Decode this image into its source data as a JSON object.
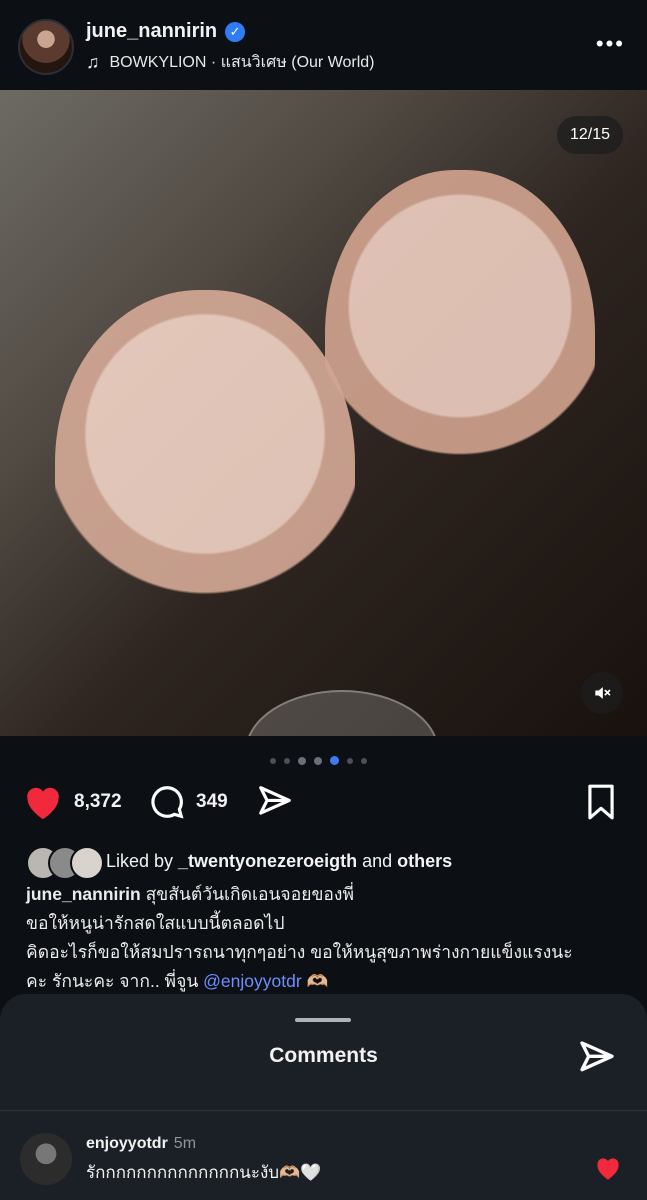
{
  "header": {
    "username": "june_nannirin",
    "music": "BOWKYLION · แสนวิเศษ (Our World)"
  },
  "photo": {
    "counter": "12/15"
  },
  "actions": {
    "likes": "8,372",
    "comments": "349"
  },
  "liked_by": {
    "prefix": "Liked by ",
    "user": "_twentyonezeroeigth",
    "middle": " and ",
    "others": "others"
  },
  "caption": {
    "user": "june_nannirin",
    "line1": " สุขสันต์วันเกิดเอนจอยของพี่",
    "line2": "ขอให้หนูน่ารักสดใสแบบนี้ตลอดไป",
    "line3": "คิดอะไรก็ขอให้สมปรารถนาทุกๆอย่าง ขอให้หนูสุขภาพร่างกายแข็งแรงนะ",
    "line4_prefix": "คะ รักนะคะ จาก.. พี่จูน ",
    "mention": "@enjoyyotdr",
    "emoji": "🫶🏼"
  },
  "sheet": {
    "title": "Comments"
  },
  "comment": {
    "user": "enjoyyotdr",
    "time": "5m",
    "text": "รักกกกกกกกกกกกกกนะงับ🫶🏼🤍"
  }
}
